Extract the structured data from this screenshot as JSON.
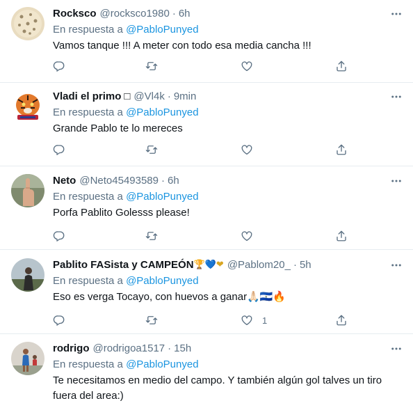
{
  "replies": [
    {
      "display_name": "Rocksco",
      "name_suffix": "",
      "handle": "@rocksco1980",
      "separator": "·",
      "time": "6h",
      "reply_prefix": "En respuesta a",
      "reply_to": "@PabloPunyed",
      "text": "Vamos tanque !!! A meter con todo esa media cancha !!!",
      "like_count": ""
    },
    {
      "display_name": "Vladi el primo",
      "name_suffix": "□",
      "handle": "@Vl4k",
      "separator": "·",
      "time": "9min",
      "reply_prefix": "En respuesta a",
      "reply_to": "@PabloPunyed",
      "text": "Grande Pablo te lo mereces",
      "like_count": ""
    },
    {
      "display_name": "Neto",
      "name_suffix": "",
      "handle": "@Neto45493589",
      "separator": "·",
      "time": "6h",
      "reply_prefix": "En respuesta a",
      "reply_to": "@PabloPunyed",
      "text": "Porfa Pablito Golesss please!",
      "like_count": ""
    },
    {
      "display_name": "Pablito FASista y CAMPEÓN",
      "name_suffix": "🏆💙❤",
      "handle": "@Pablom20_",
      "separator": "·",
      "time": "5h",
      "reply_prefix": "En respuesta a",
      "reply_to": "@PabloPunyed",
      "text": "Eso es verga Tocayo, con huevos a ganar🙏🏻🇸🇻🔥",
      "like_count": "1"
    },
    {
      "display_name": "rodrigo",
      "name_suffix": "",
      "handle": "@rodrigoa1517",
      "separator": "·",
      "time": "15h",
      "reply_prefix": "En respuesta a",
      "reply_to": "@PabloPunyed",
      "text": "Te necesitamos en medio del campo. Y también algún gol talves un tiro fuera del area:)",
      "like_count": ""
    }
  ],
  "icons": {
    "more": "more-icon",
    "reply": "reply-icon",
    "retweet": "retweet-icon",
    "like": "like-icon",
    "share": "share-icon"
  },
  "colors": {
    "link": "#1b95e0",
    "secondary_text": "#5b7083",
    "primary_text": "#0f1419",
    "divider": "#e6ecf0"
  }
}
